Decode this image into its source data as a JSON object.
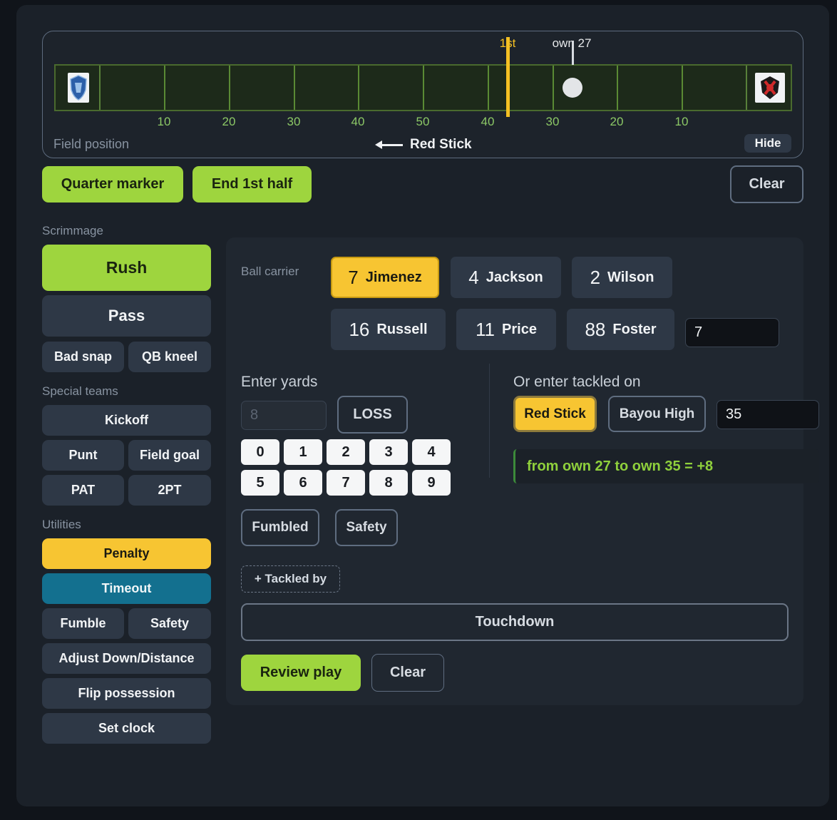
{
  "field": {
    "first_label": "1st",
    "ball_label": "own 27",
    "yard_labels": [
      "10",
      "20",
      "30",
      "40",
      "50",
      "40",
      "30",
      "20",
      "10"
    ],
    "caption": "Field position",
    "direction_team": "Red Stick",
    "hide_label": "Hide",
    "colors": {
      "first_down": "#f4c023",
      "turf": "#1d2a1a",
      "yard_line": "#5a8a34"
    },
    "left_logo": "blue-knight-logo",
    "right_logo": "red-dragon-logo"
  },
  "top_actions": {
    "quarter_marker": "Quarter marker",
    "end_half": "End 1st half",
    "clear": "Clear"
  },
  "sidebar": {
    "scrimmage_label": "Scrimmage",
    "rush": "Rush",
    "pass": "Pass",
    "bad_snap": "Bad snap",
    "qb_kneel": "QB kneel",
    "special_label": "Special teams",
    "kickoff": "Kickoff",
    "punt": "Punt",
    "field_goal": "Field goal",
    "pat": "PAT",
    "two_pt": "2PT",
    "utilities_label": "Utilities",
    "penalty": "Penalty",
    "timeout": "Timeout",
    "fumble": "Fumble",
    "safety": "Safety",
    "adjust": "Adjust Down/Distance",
    "flip": "Flip possession",
    "set_clock": "Set clock"
  },
  "play": {
    "ball_carrier_label": "Ball carrier",
    "players": [
      {
        "num": "7",
        "name": "Jimenez",
        "selected": true
      },
      {
        "num": "4",
        "name": "Jackson"
      },
      {
        "num": "2",
        "name": "Wilson"
      },
      {
        "num": "16",
        "name": "Russell"
      },
      {
        "num": "11",
        "name": "Price"
      },
      {
        "num": "88",
        "name": "Foster"
      }
    ],
    "carrier_input": "7",
    "enter_yards_label": "Enter yards",
    "yards_placeholder": "8",
    "loss_label": "LOSS",
    "keys": [
      "0",
      "1",
      "2",
      "3",
      "4",
      "5",
      "6",
      "7",
      "8",
      "9"
    ],
    "fumbled": "Fumbled",
    "safety": "Safety",
    "tackled_by": "+ Tackled by",
    "tackled_on_label": "Or enter tackled on",
    "team_a": "Red Stick",
    "team_b": "Bayou High",
    "tackled_on_value": "35",
    "result": "from own 27 to own 35 = +8",
    "touchdown": "Touchdown",
    "review": "Review play",
    "clear": "Clear"
  }
}
